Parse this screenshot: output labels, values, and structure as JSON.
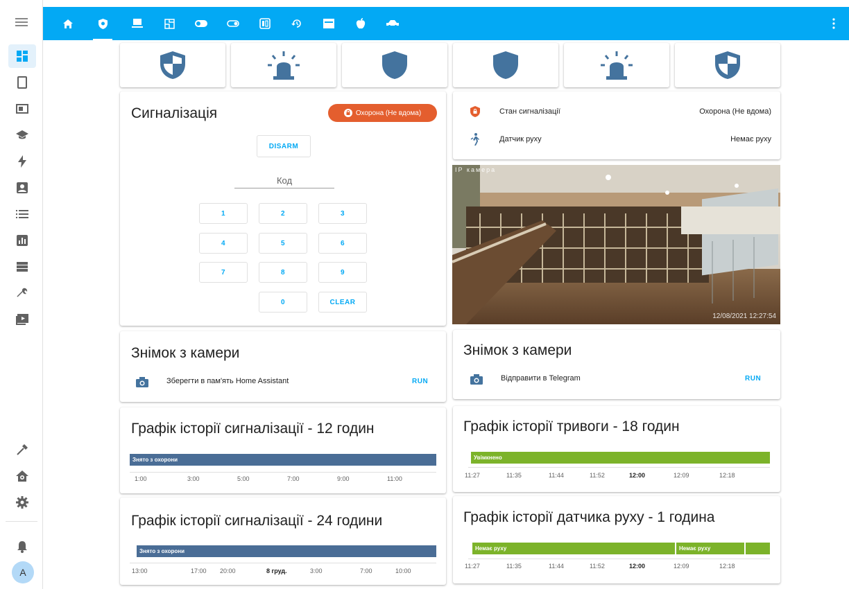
{
  "colors": {
    "accent": "#03a9f4",
    "armed_badge": "#e45e2e",
    "disarmed_bar": "#4a6d96",
    "green_bar": "#7cb32a"
  },
  "sidebar": {
    "menu_icon": "hamburger-icon",
    "items": [
      "dashboard-icon",
      "tablet-icon",
      "server-card-icon",
      "school-icon",
      "flash-icon",
      "account-box-icon",
      "list-icon",
      "chart-icon",
      "storage-icon",
      "wrench-icon",
      "media-icon"
    ],
    "bottom_items": [
      "hammer-icon",
      "home-gear-icon",
      "settings-icon",
      "notifications-icon"
    ],
    "avatar_initial": "A"
  },
  "topbar": {
    "tabs": [
      "home-icon",
      "shield-icon",
      "monitor-icon",
      "floor-plan-icon",
      "toggle-icon",
      "toggle-outline-icon",
      "switch-icon",
      "history-icon",
      "window-icon",
      "apple-icon",
      "car-icon"
    ],
    "active_tab": 1,
    "menu_icon": "dots-vertical-icon"
  },
  "alarm_panel": {
    "title": "Сигналізація",
    "state_badge": "Охорона (Не вдома)",
    "disarm_label": "DISARM",
    "code_label": "Код",
    "keys": [
      "1",
      "2",
      "3",
      "4",
      "5",
      "6",
      "7",
      "8",
      "9",
      "0"
    ],
    "clear_label": "CLEAR"
  },
  "entities": [
    {
      "name": "Стан сигналізації",
      "state": "Охорона (Не вдома)",
      "icon": "shield-lock-icon"
    },
    {
      "name": "Датчик руху",
      "state": "Немає руху",
      "icon": "walk-icon"
    }
  ],
  "camera": {
    "label": "IP камера",
    "timestamp": "12/08/2021 12:27:54"
  },
  "snapshot_left": {
    "title": "Знімок з камери",
    "action": "Зберегти в пам'ять Home Assistant",
    "run_label": "RUN"
  },
  "snapshot_right": {
    "title": "Знімок з камери",
    "action": "Відправити в Telegram",
    "run_label": "RUN"
  },
  "history": [
    {
      "title": "Графік історії сигналізації - 12 годин",
      "bars": [
        "Знято з охорони"
      ],
      "ticks": [
        "1:00",
        "3:00",
        "5:00",
        "7:00",
        "9:00",
        "11:00"
      ]
    },
    {
      "title": "Графік історії тривоги - 18 годин",
      "bars": [
        "Увімкнено"
      ],
      "ticks": [
        "11:27",
        "11:35",
        "11:44",
        "11:52",
        "12:00",
        "12:09",
        "12:18"
      ]
    },
    {
      "title": "Графік історії сигналізації - 24 години",
      "bars": [
        "Знято з охорони"
      ],
      "ticks": [
        "13:00",
        "17:00",
        "20:00",
        "8 груд.",
        "3:00",
        "7:00",
        "10:00"
      ]
    },
    {
      "title": "Графік історії датчика руху - 1 година",
      "bars": [
        "Немає руху",
        "Немає руху"
      ],
      "ticks": [
        "11:27",
        "11:35",
        "11:44",
        "11:52",
        "12:00",
        "12:09",
        "12:18"
      ]
    }
  ]
}
